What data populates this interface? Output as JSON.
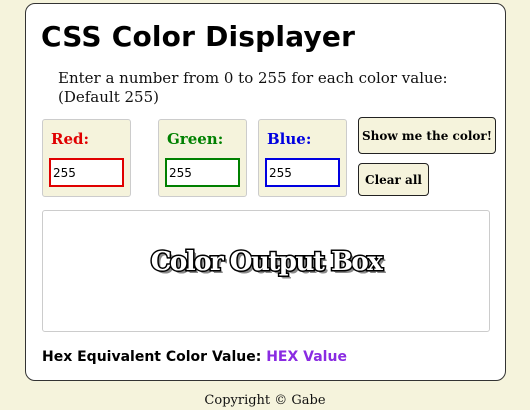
{
  "header": {
    "title": "CSS Color Displayer"
  },
  "instructions": {
    "line1": "Enter a number from 0 to 255 for each color value:",
    "line2": "(Default 255)"
  },
  "colors": {
    "red": {
      "label": "Red:",
      "value": "255",
      "color": "#e00000"
    },
    "green": {
      "label": "Green:",
      "value": "255",
      "color": "#008000"
    },
    "blue": {
      "label": "Blue:",
      "value": "255",
      "color": "#0000e0"
    }
  },
  "buttons": {
    "show_label": "Show me the color!",
    "clear_label": "Clear all"
  },
  "output": {
    "text": "Color Output Box"
  },
  "hex": {
    "label": "Hex Equivalent Color Value:",
    "value": "HEX Value",
    "value_color": "#8a2be2"
  },
  "footer": {
    "copyright": "Copyright © Gabe"
  }
}
